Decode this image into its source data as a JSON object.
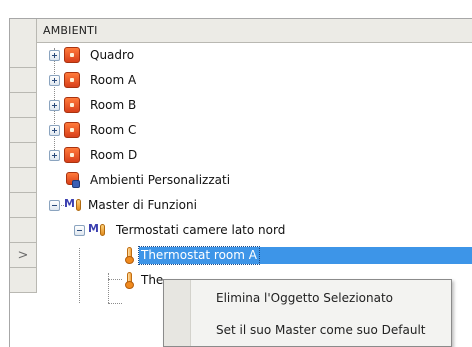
{
  "header": {
    "title": "AMBIENTI"
  },
  "tree": {
    "items": [
      {
        "label": "Quadro",
        "icon": "room-icon",
        "expandable": true
      },
      {
        "label": "Room A",
        "icon": "room-icon",
        "expandable": true
      },
      {
        "label": "Room B",
        "icon": "room-icon",
        "expandable": true
      },
      {
        "label": "Room C",
        "icon": "room-icon",
        "expandable": true
      },
      {
        "label": "Room D",
        "icon": "room-icon",
        "expandable": true
      },
      {
        "label": "Ambienti Personalizzati",
        "icon": "custom-rooms-icon",
        "expandable": false
      },
      {
        "label": "Master di Funzioni",
        "icon": "master-functions-icon",
        "expanded": true
      },
      {
        "label": "Termostati camere lato nord",
        "icon": "master-functions-icon",
        "expanded": true
      },
      {
        "label": "Thermostat room A",
        "icon": "thermostat-icon",
        "selected": true
      },
      {
        "label": "The",
        "icon": "thermostat-icon"
      }
    ]
  },
  "gutter": {
    "current_row_marker": ">"
  },
  "context_menu": {
    "items": [
      {
        "label": "Elimina l'Oggetto Selezionato"
      },
      {
        "label": "Set il suo Master come suo Default"
      }
    ]
  },
  "colors": {
    "selection": "#3d95e8",
    "room_icon": "#e8552a",
    "header_bg": "#ecebe6"
  }
}
